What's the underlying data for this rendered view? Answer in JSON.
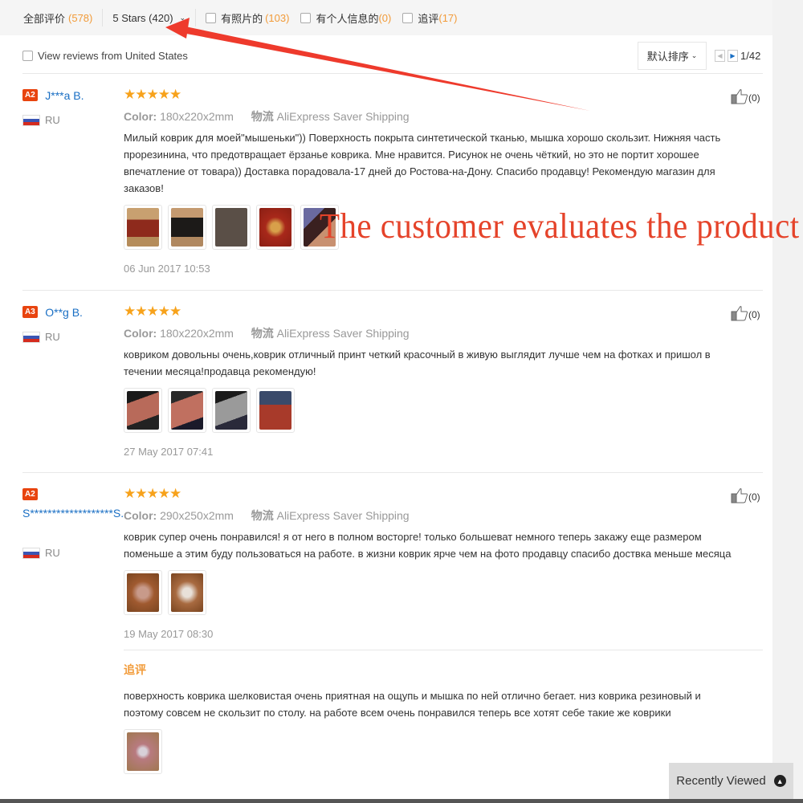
{
  "filter_bar": {
    "all_label": "全部评价",
    "all_count": "(578)",
    "stars_filter": "5 Stars (420)",
    "photos_label": "有照片的",
    "photos_count": "(103)",
    "personal_label": "有个人信息的",
    "personal_count": "(0)",
    "followup_label": "追评",
    "followup_count": "(17)"
  },
  "sub_bar": {
    "us_filter_label": "View reviews from United States",
    "sort_label": "默认排序",
    "page": "1/42"
  },
  "annotation": "The customer evaluates the product",
  "reviews": [
    {
      "badge": "A2",
      "user": "J***a B.",
      "country": "RU",
      "stars": "★★★★★",
      "rating": 5,
      "color_label": "Color:",
      "color_value": "180x220x2mm",
      "shipping_label": "物流",
      "shipping_value": "AliExpress Saver Shipping",
      "text": "Милый коврик для моей\"мышеньки\")) Поверхность покрыта синтетической тканью, мышка хорошо скользит. Нижняя часть прорезинина, что предотвращает ёрзанье коврика. Мне нравится. Рисунок не очень чёткий, но это не портит хорошее впечатление от товара)) Доставка порадовала-17 дней до Ростова-на-Дону. Спасибо продавцу! Рекомендую магазин для заказов!",
      "photos": 5,
      "date": "06 Jun 2017 10:53",
      "likes": "(0)"
    },
    {
      "badge": "A3",
      "user": "O**g B.",
      "country": "RU",
      "stars": "★★★★★",
      "rating": 5,
      "color_label": "Color:",
      "color_value": "180x220x2mm",
      "shipping_label": "物流",
      "shipping_value": "AliExpress Saver Shipping",
      "text": "ковриком довольны очень,коврик отличный принт четкий красочный в живую выглядит лучше чем на фотках и пришол в течении месяца!продавца рекомендую!",
      "photos": 4,
      "date": "27 May 2017 07:41",
      "likes": "(0)"
    },
    {
      "badge": "A2",
      "user": "S*******************S.",
      "country": "RU",
      "stars": "★★★★★",
      "rating": 5,
      "color_label": "Color:",
      "color_value": "290x250x2mm",
      "shipping_label": "物流",
      "shipping_value": "AliExpress Saver Shipping",
      "text": "коврик супер очень понравился! я от него в полном восторге! только большеват немного теперь закажу еще размером поменьше а этим буду пользоваться на работе. в жизни коврик ярче чем на фото продавцу спасибо доствка меньше месяца",
      "photos": 2,
      "date": "19 May 2017 08:30",
      "likes": "(0)",
      "followup_title": "追评",
      "followup_text": "поверхность коврика шелковистая очень приятная на ощупь и мышка по ней отлично бегает. низ коврика резиновый и поэтому совсем не скользит по столу. на работе всем очень понравился теперь все хотят себе такие же коврики",
      "followup_photos": 1
    }
  ],
  "recently_viewed": "Recently Viewed",
  "colors": {
    "accent_orange": "#f29b39",
    "star": "#f7a21b",
    "link_blue": "#1a6fc4",
    "badge_red": "#e8440f",
    "annotation_red": "#e5432a"
  }
}
